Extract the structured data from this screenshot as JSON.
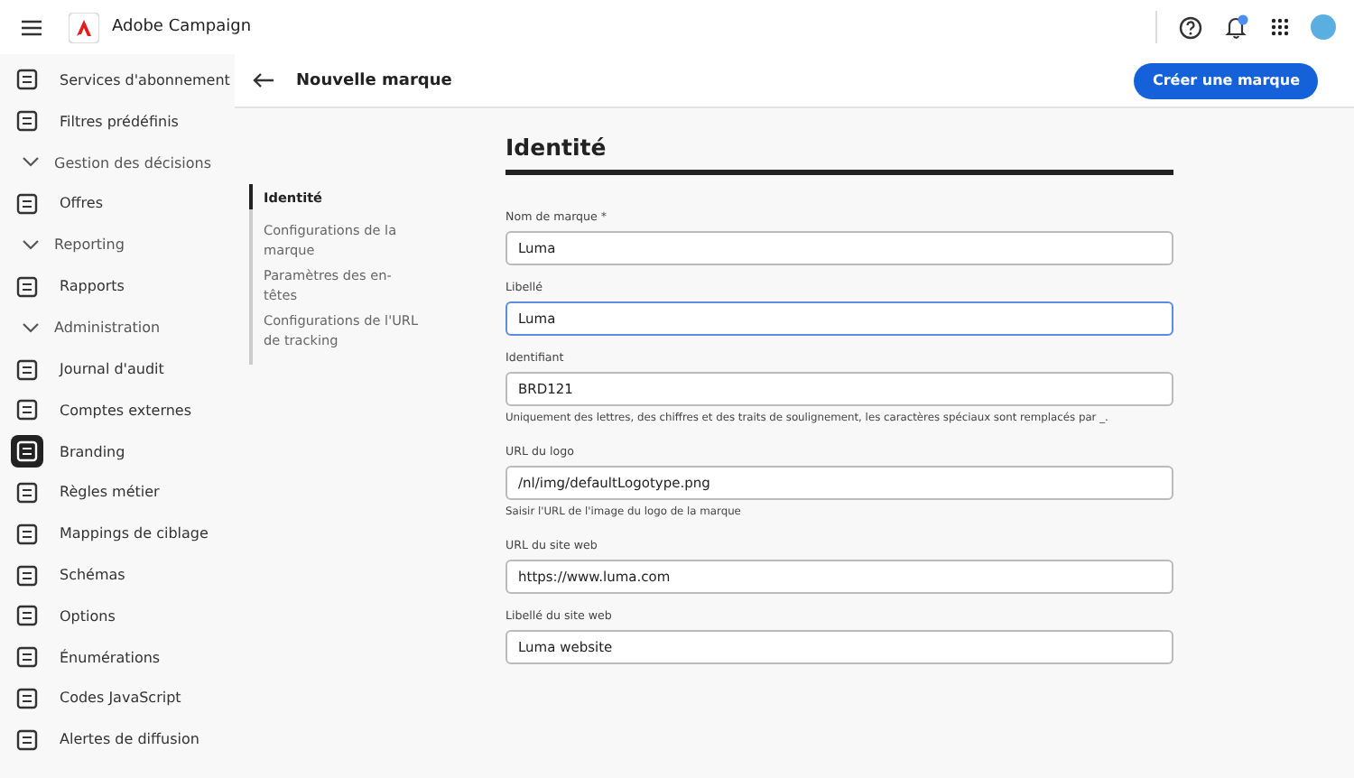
{
  "app": {
    "title": "Adobe Campaign"
  },
  "sidebar": {
    "items": [
      {
        "kind": "item",
        "label": "Services d'abonnement",
        "selected": false
      },
      {
        "kind": "item",
        "label": "Filtres prédéfinis",
        "selected": false
      },
      {
        "kind": "section",
        "label": "Gestion des décisions",
        "expanded": true
      },
      {
        "kind": "item",
        "label": "Offres",
        "selected": false
      },
      {
        "kind": "section",
        "label": "Reporting",
        "expanded": true
      },
      {
        "kind": "item",
        "label": "Rapports",
        "selected": false
      },
      {
        "kind": "section",
        "label": "Administration",
        "expanded": true
      },
      {
        "kind": "item",
        "label": "Journal d'audit",
        "selected": false
      },
      {
        "kind": "item",
        "label": "Comptes externes",
        "selected": false
      },
      {
        "kind": "item",
        "label": "Branding",
        "selected": true
      },
      {
        "kind": "item",
        "label": "Règles métier",
        "selected": false
      },
      {
        "kind": "item",
        "label": "Mappings de ciblage",
        "selected": false
      },
      {
        "kind": "item",
        "label": "Schémas",
        "selected": false
      },
      {
        "kind": "item",
        "label": "Options",
        "selected": false
      },
      {
        "kind": "item",
        "label": "Énumérations",
        "selected": false
      },
      {
        "kind": "item",
        "label": "Codes JavaScript",
        "selected": false
      },
      {
        "kind": "item",
        "label": "Alertes de diffusion",
        "selected": false
      }
    ]
  },
  "page": {
    "title": "Nouvelle marque",
    "primary_button": "Créer une marque"
  },
  "section_nav": [
    {
      "label": "Identité",
      "selected": true
    },
    {
      "label": "Configurations de la marque",
      "selected": false
    },
    {
      "label": "Paramètres des en-têtes",
      "selected": false
    },
    {
      "label": "Configurations de l'URL de tracking",
      "selected": false
    }
  ],
  "form": {
    "heading": "Identité",
    "fields": [
      {
        "label": "Nom de marque *",
        "value": "Luma",
        "focused": false
      },
      {
        "label": "Libellé",
        "value": "Luma",
        "focused": true
      },
      {
        "label": "Identifiant",
        "value": "BRD121",
        "focused": false,
        "help": "Uniquement des lettres, des chiffres et des traits de soulignement, les caractères spéciaux sont remplacés par _."
      },
      {
        "label": "URL du logo",
        "value": "/nl/img/defaultLogotype.png",
        "focused": false,
        "help": "Saisir l'URL de l'image du logo de la marque"
      },
      {
        "label": "URL du site web",
        "value": "https://www.luma.com",
        "focused": false
      },
      {
        "label": "Libellé du site web",
        "value": "Luma website",
        "focused": false
      }
    ]
  }
}
